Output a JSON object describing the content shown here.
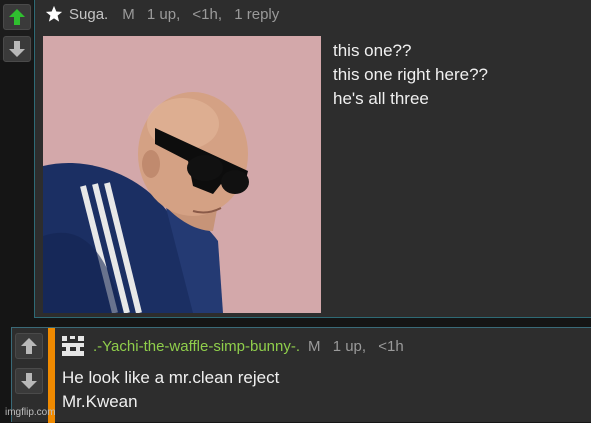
{
  "post": {
    "username": "Suga.",
    "mod_badge": "M",
    "votes": "1 up,",
    "time": "<1h,",
    "replies": "1 reply",
    "lines": [
      "this one??",
      "this one right here??",
      "he's all three"
    ]
  },
  "reply": {
    "username": ".-Yachi-the-waffle-simp-bunny-.",
    "mod_badge": "M",
    "votes": "1 up,",
    "time": "<1h",
    "lines": [
      "He look like a mr.clean reject",
      "Mr.Kwean"
    ]
  },
  "watermark": "imgflip.com",
  "icons": {
    "star": "star-icon",
    "upvote": "arrow-up-icon",
    "downvote": "arrow-down-icon",
    "avatar": "pixel-avatar-icon"
  },
  "colors": {
    "upvote_active": "#2fbf2f",
    "arrow_inactive": "#b8b8b8",
    "reply_username": "#8fce4b",
    "accent_bar": "#f08a00",
    "border": "#2e6a75"
  }
}
